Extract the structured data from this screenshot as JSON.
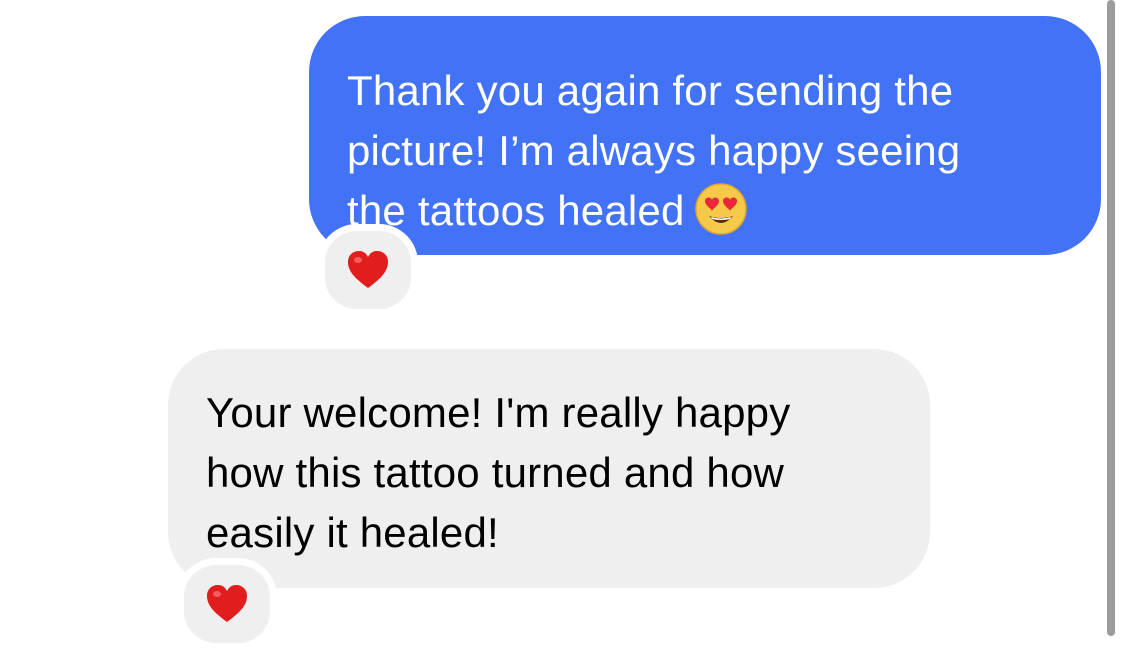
{
  "messages": [
    {
      "direction": "outgoing",
      "text": "Thank you again for sending the\npicture! I’m always happy seeing\nthe tattoos healed",
      "trailing_emoji": "smiling-face-with-heart-eyes",
      "bubble_color": "#4272f5",
      "text_color": "#ffffff",
      "reaction": "heart"
    },
    {
      "direction": "incoming",
      "text": "Your welcome! I'm really happy\nhow this tattoo turned and how\neasily it healed!",
      "bubble_color": "#efeff0",
      "text_color": "#000000",
      "reaction": "heart"
    }
  ],
  "reaction_color": "#e11d1d"
}
